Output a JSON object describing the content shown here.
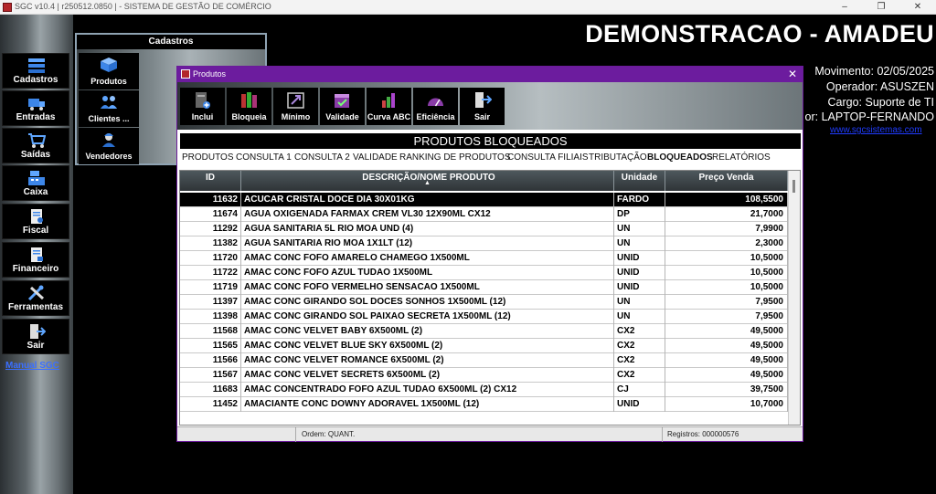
{
  "window": {
    "title": "SGC v10.4 | r250512.0850 | - SISTEMA DE GESTÃO DE COMÉRCIO"
  },
  "sidebar": {
    "items": [
      {
        "label": "Cadastros",
        "icon": "stack-icon"
      },
      {
        "label": "Entradas",
        "icon": "truck-icon"
      },
      {
        "label": "Saídas",
        "icon": "cart-icon"
      },
      {
        "label": "Caixa",
        "icon": "cash-register-icon"
      },
      {
        "label": "Fiscal",
        "icon": "fiscal-document-icon"
      },
      {
        "label": "Financeiro",
        "icon": "finance-document-icon"
      },
      {
        "label": "Ferramentas",
        "icon": "tools-icon"
      },
      {
        "label": "Sair",
        "icon": "exit-door-icon"
      }
    ],
    "manual_link": "Manual SGC"
  },
  "cadastros_menu": {
    "title": "Cadastros",
    "items": [
      {
        "label": "Produtos",
        "icon": "box-icon"
      },
      {
        "label": "Clientes ...",
        "icon": "people-icon"
      },
      {
        "label": "Vendedores",
        "icon": "salesperson-icon"
      }
    ]
  },
  "header": {
    "company": "DEMONSTRACAO - AMADEU",
    "movimento": "Movimento: 02/05/2025",
    "operador": "Operador: ASUSZEN",
    "cargo": "Cargo: Suporte de TI",
    "computador": "or: LAPTOP-FERNANDO",
    "site": "www.sgcsistemas.com"
  },
  "produtos_window": {
    "title": "Produtos",
    "toolbar": [
      {
        "label": "Inclui",
        "icon": "add-document-icon"
      },
      {
        "label": "Bloqueia",
        "icon": "books-lock-icon"
      },
      {
        "label": "Mínimo",
        "icon": "minimum-arrow-icon"
      },
      {
        "label": "Validade",
        "icon": "calendar-check-icon"
      },
      {
        "label": "Curva ABC",
        "icon": "bar-chart-icon"
      },
      {
        "label": "Eficiência",
        "icon": "gauge-icon"
      },
      {
        "label": "Sair",
        "icon": "exit-door-icon"
      }
    ],
    "subtitle": "PRODUTOS BLOQUEADOS",
    "tabs": [
      "PRODUTOS",
      "CONSULTA 1",
      "CONSULTA 2",
      "VALIDADE",
      "RANKING DE PRODUTOS",
      "CONSULTA FILIAIS",
      "TRIBUTAÇÃO",
      "BLOQUEADOS",
      "RELATÓRIOS"
    ],
    "active_tab": "BLOQUEADOS",
    "columns": {
      "id": "ID",
      "descricao": "DESCRIÇÃO/NOME PRODUTO",
      "unidade": "Unidade",
      "preco": "Preço Venda"
    },
    "sort_indicator": "▲",
    "rows": [
      {
        "id": "11632",
        "descricao": "ACUCAR CRISTAL DOCE DIA 30X01KG",
        "unidade": "FARDO",
        "preco": "108,5500"
      },
      {
        "id": "11674",
        "descricao": "AGUA OXIGENADA FARMAX CREM VL30 12X90ML  CX12",
        "unidade": "DP",
        "preco": "21,7000"
      },
      {
        "id": "11292",
        "descricao": "AGUA SANITARIA 5L RIO MOA UND (4)",
        "unidade": "UN",
        "preco": "7,9900"
      },
      {
        "id": "11382",
        "descricao": "AGUA SANITARIA RIO MOA 1X1LT (12)",
        "unidade": "UN",
        "preco": "2,3000"
      },
      {
        "id": "11720",
        "descricao": "AMAC CONC FOFO AMARELO CHAMEGO  1X500ML",
        "unidade": "UNID",
        "preco": "10,5000"
      },
      {
        "id": "11722",
        "descricao": "AMAC CONC FOFO AZUL TUDAO 1X500ML",
        "unidade": "UNID",
        "preco": "10,5000"
      },
      {
        "id": "11719",
        "descricao": "AMAC CONC FOFO VERMELHO SENSACAO 1X500ML",
        "unidade": "UNID",
        "preco": "10,5000"
      },
      {
        "id": "11397",
        "descricao": "AMAC CONC GIRANDO SOL DOCES SONHOS 1X500ML (12)",
        "unidade": "UN",
        "preco": "7,9500"
      },
      {
        "id": "11398",
        "descricao": "AMAC CONC GIRANDO SOL PAIXAO SECRETA 1X500ML (12)",
        "unidade": "UN",
        "preco": "7,9500"
      },
      {
        "id": "11568",
        "descricao": "AMAC CONC VELVET BABY  6X500ML (2)",
        "unidade": "CX2",
        "preco": "49,5000"
      },
      {
        "id": "11565",
        "descricao": "AMAC CONC VELVET BLUE SKY  6X500ML (2)",
        "unidade": "CX2",
        "preco": "49,5000"
      },
      {
        "id": "11566",
        "descricao": "AMAC CONC VELVET ROMANCE  6X500ML (2)",
        "unidade": "CX2",
        "preco": "49,5000"
      },
      {
        "id": "11567",
        "descricao": "AMAC CONC VELVET SECRETS  6X500ML (2)",
        "unidade": "CX2",
        "preco": "49,5000"
      },
      {
        "id": "11683",
        "descricao": "AMAC CONCENTRADO FOFO AZUL TUDAO  6X500ML  (2) CX12",
        "unidade": "CJ",
        "preco": "39,7500"
      },
      {
        "id": "11452",
        "descricao": "AMACIANTE CONC DOWNY ADORAVEL 1X500ML (12)",
        "unidade": "UNID",
        "preco": "10,7000"
      }
    ],
    "status_ordem": "Ordem: QUANT.",
    "status_registros": "Registros: 000000576"
  },
  "colors": {
    "window_title_purple": "#6c1c9e",
    "link_blue": "#3b6fff",
    "selected_row": "#000000"
  }
}
